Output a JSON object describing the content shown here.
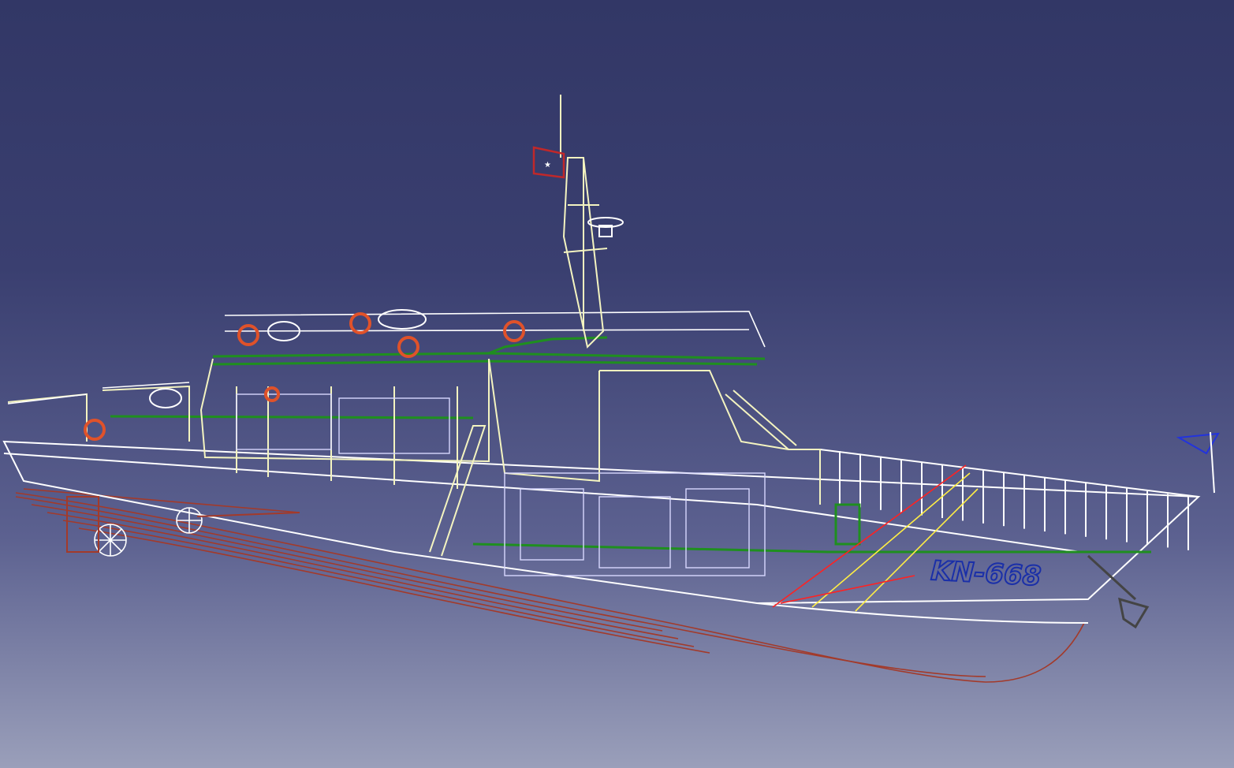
{
  "viewport": {
    "background_top": "#323766",
    "background_bottom": "#9a9fba"
  },
  "model": {
    "hull_number": "KN-668",
    "colors": {
      "superstructure": "#f4f4c0",
      "railing": "#ffffff",
      "deck": "#1f8f1f",
      "hull_outline": "#ffffff",
      "underwater_hull": "#a33a2a",
      "hull_number": "#1a2fa8",
      "lifebuoy": "#e0522a",
      "flag": "#c0282a",
      "bow_flag": "#2233dd",
      "anchor": "#444444",
      "yellow_lines": "#ffee44",
      "red_lines": "#ff2222"
    },
    "icons": [
      "flag-icon",
      "radar-icon",
      "lifebuoy-icon",
      "propeller-icon",
      "anchor-icon"
    ]
  }
}
